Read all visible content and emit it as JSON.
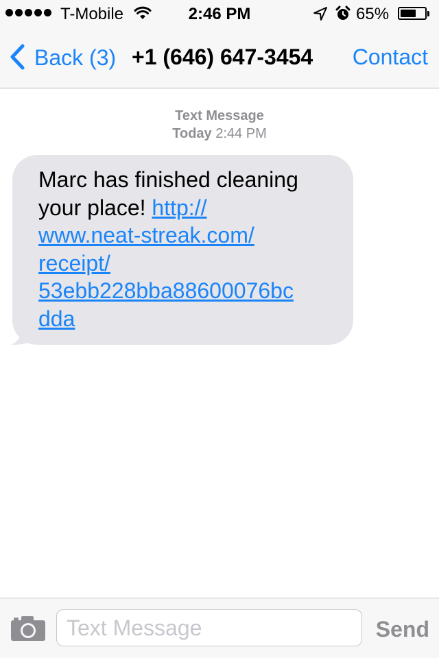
{
  "status_bar": {
    "carrier": "T-Mobile",
    "time": "2:46 PM",
    "battery_percent": "65%",
    "battery_level": 0.65,
    "signal_bars": 5,
    "icons": [
      "signal-dots-icon",
      "wifi-icon",
      "location-arrow-icon",
      "alarm-clock-icon",
      "battery-icon"
    ]
  },
  "nav": {
    "back_label": "Back (3)",
    "title": "+1 (646) 647-3454",
    "contact_label": "Contact"
  },
  "thread": {
    "service_label": "Text Message",
    "day_label": "Today",
    "time_label": "2:44 PM"
  },
  "messages": [
    {
      "direction": "incoming",
      "text": "Marc has finished cleaning your place!",
      "link_lines": [
        "http://",
        "www.neat-streak.com/",
        "receipt/",
        "53ebb228bba88600076bc",
        "dda"
      ]
    }
  ],
  "composer": {
    "placeholder": "Text Message",
    "value": "",
    "send_label": "Send"
  },
  "colors": {
    "accent": "#1a84f8",
    "bubble_incoming": "#e5e5ea",
    "meta_text": "#8e8e93",
    "bar_background": "#f7f7f8"
  }
}
